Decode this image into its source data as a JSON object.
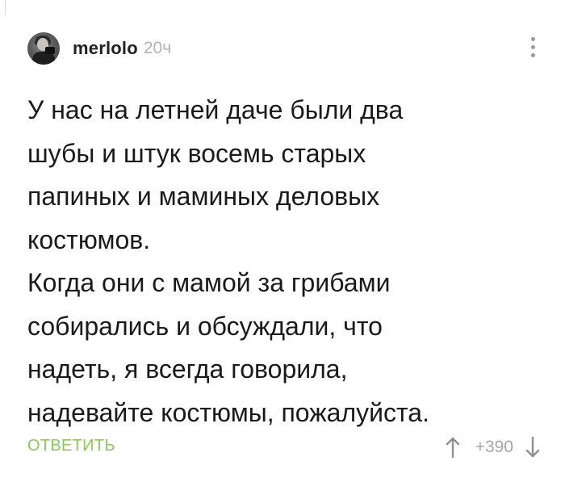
{
  "comment": {
    "author": "merlolo",
    "time": "20ч",
    "text": "У нас на летней даче были два\nшубы и штук восемь старых\nпапиных и маминых деловых\nкостюмов.\nКогда они с мамой за грибами\nсобирались и обсуждали, что\nнадеть, я всегда говорила,\nнадевайте костюмы, пожалуйста.",
    "reply_label": "ОТВЕТИТЬ",
    "rating": "+390"
  },
  "icons": {
    "avatar": "user-avatar-photo",
    "menu": "more-vertical-icon",
    "upvote": "arrow-up-icon",
    "downvote": "arrow-down-icon"
  },
  "colors": {
    "accent": "#8ac858",
    "text": "#1a1a1a",
    "muted": "#b3b3b3",
    "icon": "#9a9a9a"
  }
}
